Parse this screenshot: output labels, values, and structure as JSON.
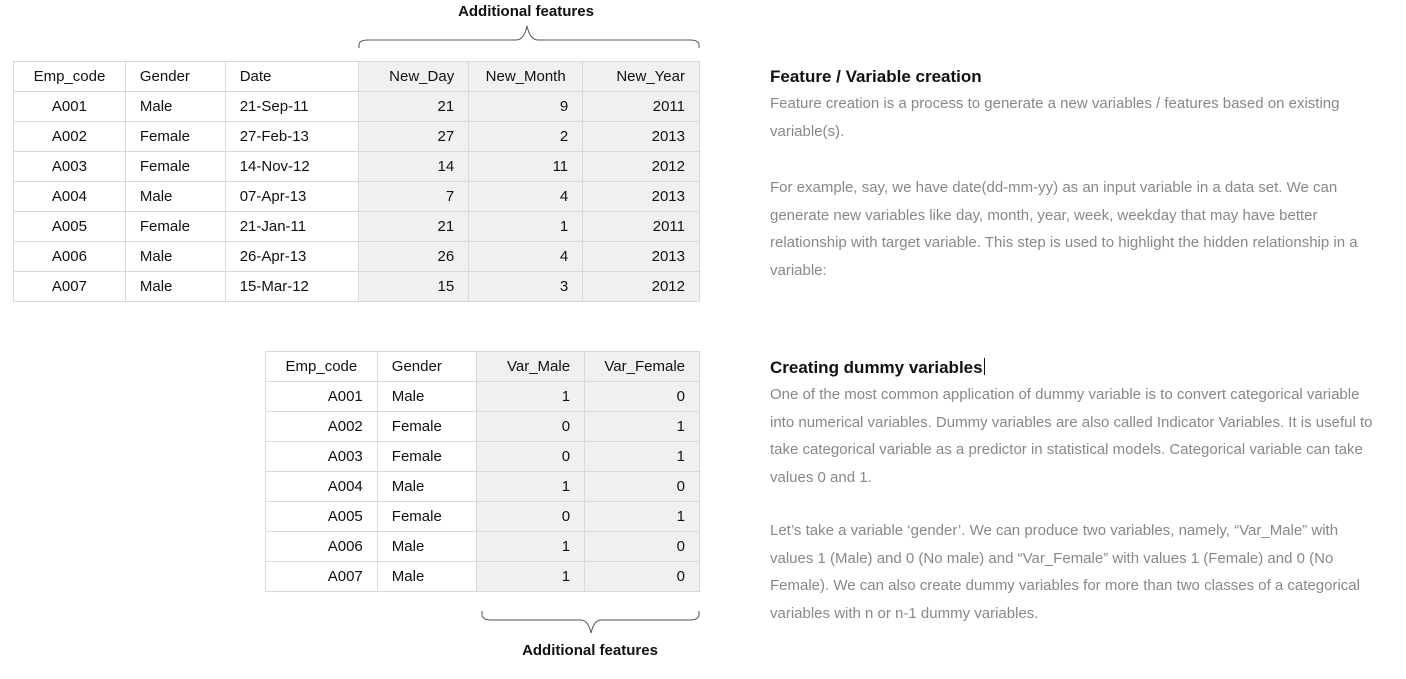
{
  "top_caption": "Additional features",
  "bottom_caption": "Additional features",
  "table1": {
    "headers": [
      "Emp_code",
      "Gender",
      "Date",
      "New_Day",
      "New_Month",
      "New_Year"
    ],
    "rows": [
      [
        "A001",
        "Male",
        "21-Sep-11",
        "21",
        "9",
        "2011"
      ],
      [
        "A002",
        "Female",
        "27-Feb-13",
        "27",
        "2",
        "2013"
      ],
      [
        "A003",
        "Female",
        "14-Nov-12",
        "14",
        "11",
        "2012"
      ],
      [
        "A004",
        "Male",
        "07-Apr-13",
        "7",
        "4",
        "2013"
      ],
      [
        "A005",
        "Female",
        "21-Jan-11",
        "21",
        "1",
        "2011"
      ],
      [
        "A006",
        "Male",
        "26-Apr-13",
        "26",
        "4",
        "2013"
      ],
      [
        "A007",
        "Male",
        "15-Mar-12",
        "15",
        "3",
        "2012"
      ]
    ]
  },
  "table2": {
    "headers": [
      "Emp_code",
      "Gender",
      "Var_Male",
      "Var_Female"
    ],
    "rows": [
      [
        "A001",
        "Male",
        "1",
        "0"
      ],
      [
        "A002",
        "Female",
        "0",
        "1"
      ],
      [
        "A003",
        "Female",
        "0",
        "1"
      ],
      [
        "A004",
        "Male",
        "1",
        "0"
      ],
      [
        "A005",
        "Female",
        "0",
        "1"
      ],
      [
        "A006",
        "Male",
        "1",
        "0"
      ],
      [
        "A007",
        "Male",
        "1",
        "0"
      ]
    ]
  },
  "section1": {
    "title": "Feature / Variable creation",
    "para1": "Feature creation is a process to generate a new variables / features based on existing variable(s).",
    "para2": "For example, say, we have date(dd-mm-yy) as an input variable in a data set. We can generate new variables like day, month, year, week, weekday that may have better relationship with target variable. This step is used to highlight the hidden relationship in a variable:"
  },
  "section2": {
    "title": "Creating dummy variables",
    "para1": "One of the most common application of dummy variable is to convert categorical variable into numerical variables. Dummy variables are also called Indicator Variables. It is useful to take categorical variable as a predictor in statistical models.  Categorical variable can take values 0 and 1.",
    "para2": " Let’s take a variable ‘gender’. We can produce two variables, namely, “Var_Male” with values 1 (Male) and 0 (No male) and “Var_Female” with values 1 (Female) and 0 (No Female). We can also create dummy variables for more than two classes of a categorical variables with n or n-1 dummy variables."
  }
}
